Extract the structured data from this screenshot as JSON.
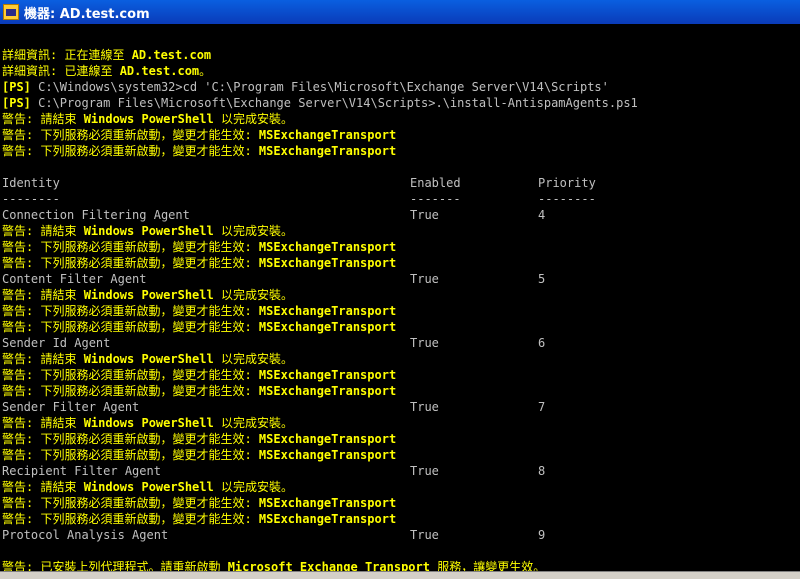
{
  "window": {
    "title": "機器: AD.test.com"
  },
  "lines": [
    {
      "type": "blank"
    },
    {
      "type": "info",
      "prefix": "詳細資訊: 正在連線至 ",
      "host": "AD.test.com",
      "suffix": ""
    },
    {
      "type": "info",
      "prefix": "詳細資訊: 已連線至 ",
      "host": "AD.test.com",
      "suffix": "。"
    },
    {
      "type": "cmd",
      "prompt": "[PS]",
      "text": " C:\\Windows\\system32>cd 'C:\\Program Files\\Microsoft\\Exchange Server\\V14\\Scripts'"
    },
    {
      "type": "cmd",
      "prompt": "[PS]",
      "text": " C:\\Program Files\\Microsoft\\Exchange Server\\V14\\Scripts>.\\install-AntispamAgents.ps1"
    },
    {
      "type": "warn1"
    },
    {
      "type": "warn2"
    },
    {
      "type": "warn2"
    },
    {
      "type": "blank"
    },
    {
      "type": "header"
    },
    {
      "type": "sep"
    },
    {
      "type": "row",
      "idx": 0
    },
    {
      "type": "warn1"
    },
    {
      "type": "warn2"
    },
    {
      "type": "warn2"
    },
    {
      "type": "row",
      "idx": 1
    },
    {
      "type": "warn1"
    },
    {
      "type": "warn2"
    },
    {
      "type": "warn2"
    },
    {
      "type": "row",
      "idx": 2
    },
    {
      "type": "warn1"
    },
    {
      "type": "warn2"
    },
    {
      "type": "warn2"
    },
    {
      "type": "row",
      "idx": 3
    },
    {
      "type": "warn1"
    },
    {
      "type": "warn2"
    },
    {
      "type": "warn2"
    },
    {
      "type": "row",
      "idx": 4
    },
    {
      "type": "warn1"
    },
    {
      "type": "warn2"
    },
    {
      "type": "warn2"
    },
    {
      "type": "row",
      "idx": 5
    },
    {
      "type": "blank"
    },
    {
      "type": "final"
    }
  ],
  "messages": {
    "warn1": {
      "prefix": "警告: 請結束 ",
      "hl": "Windows PowerShell",
      "suffix": " 以完成安裝。"
    },
    "warn2": {
      "prefix": "警告: 下列服務必須重新啟動，變更才能生效: ",
      "hl": "MSExchangeTransport",
      "suffix": ""
    },
    "final": {
      "p1": "警告: 已安裝上列代理程式。請重新啟動 ",
      "hl": "Microsoft Exchange Transport",
      "p2": " 服務，讓變更生效。"
    }
  },
  "table": {
    "headers": [
      "Identity",
      "Enabled",
      "Priority"
    ],
    "separators": [
      "--------",
      "-------",
      "--------"
    ],
    "rows": [
      {
        "identity": "Connection Filtering Agent",
        "enabled": "True",
        "priority": "4"
      },
      {
        "identity": "Content Filter Agent",
        "enabled": "True",
        "priority": "5"
      },
      {
        "identity": "Sender Id Agent",
        "enabled": "True",
        "priority": "6"
      },
      {
        "identity": "Sender Filter Agent",
        "enabled": "True",
        "priority": "7"
      },
      {
        "identity": "Recipient Filter Agent",
        "enabled": "True",
        "priority": "8"
      },
      {
        "identity": "Protocol Analysis Agent",
        "enabled": "True",
        "priority": "9"
      }
    ]
  },
  "colors": {
    "warning": "#ffff00",
    "normal": "#c0c0c0",
    "background": "#000000",
    "titlebar": "#0a5fe0"
  }
}
